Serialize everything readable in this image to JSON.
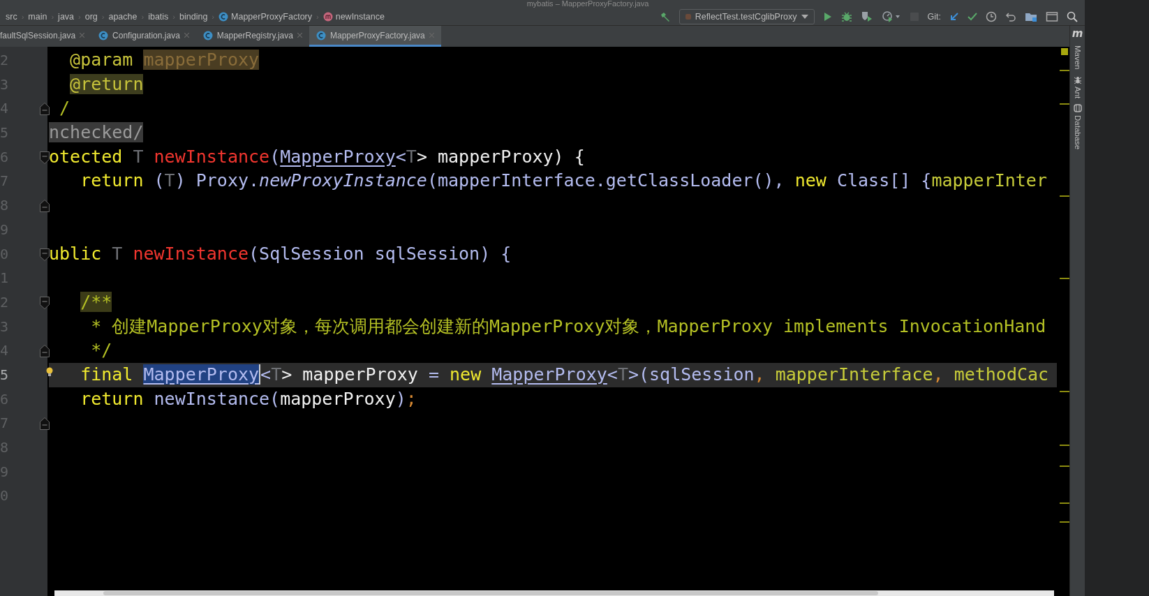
{
  "window": {
    "title": "mybatis – MapperProxyFactory.java"
  },
  "breadcrumbs": [
    {
      "label": "src",
      "kind": "folder"
    },
    {
      "separator": "›",
      "label": "main",
      "kind": "folder"
    },
    {
      "separator": "›",
      "label": "java",
      "kind": "folder"
    },
    {
      "separator": "›",
      "label": "org",
      "kind": "folder"
    },
    {
      "separator": "›",
      "label": "apache",
      "kind": "folder"
    },
    {
      "separator": "›",
      "label": "ibatis",
      "kind": "folder"
    },
    {
      "separator": "›",
      "label": "binding",
      "kind": "folder"
    },
    {
      "separator": "›",
      "label": "MapperProxyFactory",
      "kind": "class"
    },
    {
      "separator": "›",
      "label": "newInstance",
      "kind": "method"
    }
  ],
  "run_config": {
    "label": "ReflectTest.testCglibProxy"
  },
  "actions": [
    {
      "kind": "run",
      "disabled": false
    },
    {
      "kind": "debug",
      "disabled": false
    },
    {
      "kind": "coverage",
      "disabled": false
    },
    {
      "kind": "profile",
      "disabled": false
    },
    {
      "kind": "stop",
      "disabled": true
    }
  ],
  "git": {
    "label": "Git:"
  },
  "tabs": [
    {
      "label": "faultSqlSession.java",
      "icon": false,
      "selected": false
    },
    {
      "label": "Configuration.java",
      "icon": true,
      "selected": false
    },
    {
      "label": "MapperRegistry.java",
      "icon": true,
      "selected": false
    },
    {
      "label": "MapperProxyFactory.java",
      "icon": true,
      "selected": true
    }
  ],
  "tool_strip": {
    "logo": "m",
    "items": [
      {
        "label": "Maven",
        "kind": "none"
      },
      {
        "label": "Ant",
        "kind": "ant"
      },
      {
        "label": "Database",
        "kind": "database"
      }
    ]
  },
  "lines": [
    {
      "number": "2",
      "current": false,
      "bulb": false,
      "fold_start": false,
      "fold_end": false,
      "tokens": [
        {
          "text": "  @param ",
          "kind": "doctag"
        },
        {
          "text": "mapperProxy",
          "kind": "param_ref"
        }
      ]
    },
    {
      "number": "3",
      "current": false,
      "bulb": false,
      "fold_start": false,
      "fold_end": false,
      "tokens": [
        {
          "text": "  @return",
          "kind": "doctag_hl"
        }
      ]
    },
    {
      "number": "4",
      "current": false,
      "bulb": false,
      "fold_start": false,
      "fold_end": true,
      "tokens": [
        {
          "text": " /",
          "kind": "doc"
        }
      ]
    },
    {
      "number": "5",
      "current": false,
      "bulb": false,
      "fold_start": false,
      "fold_end": false,
      "tokens": [
        {
          "text": "nchecked/",
          "kind": "folded"
        }
      ]
    },
    {
      "number": "6",
      "current": false,
      "bulb": false,
      "fold_start": true,
      "fold_end": false,
      "tokens": [
        {
          "text": "otected ",
          "kind": "keyword"
        },
        {
          "text": "T ",
          "kind": "typeparam"
        },
        {
          "text": "newInstance",
          "kind": "method"
        },
        {
          "text": "(",
          "kind": "ident"
        },
        {
          "text": "MapperProxy",
          "kind": "class"
        },
        {
          "text": "<",
          "kind": "ident"
        },
        {
          "text": "T",
          "kind": "typeparam"
        },
        {
          "text": "> mapperProxy) {",
          "kind": "white"
        }
      ]
    },
    {
      "number": "7",
      "current": false,
      "bulb": false,
      "fold_start": false,
      "fold_end": false,
      "tokens": [
        {
          "text": "   return",
          "kind": "keyword"
        },
        {
          "text": " (",
          "kind": "ident"
        },
        {
          "text": "T",
          "kind": "typeparam"
        },
        {
          "text": ") Proxy.",
          "kind": "ident"
        },
        {
          "text": "newProxyInstance",
          "kind": "italic"
        },
        {
          "text": "(mapperInterface.getClassLoader(), ",
          "kind": "ident"
        },
        {
          "text": "new",
          "kind": "keyword"
        },
        {
          "text": " Class[] {",
          "kind": "ident"
        },
        {
          "text": "mapperInter",
          "kind": "field"
        }
      ]
    },
    {
      "number": "8",
      "current": false,
      "bulb": false,
      "fold_start": false,
      "fold_end": true
    },
    {
      "number": "9",
      "current": false,
      "bulb": false,
      "fold_start": false,
      "fold_end": false
    },
    {
      "number": "0",
      "current": false,
      "bulb": false,
      "fold_start": true,
      "fold_end": false,
      "tokens": [
        {
          "text": "ublic ",
          "kind": "keyword"
        },
        {
          "text": "T ",
          "kind": "typeparam"
        },
        {
          "text": "newInstance",
          "kind": "method"
        },
        {
          "text": "(SqlSession sqlSession) {",
          "kind": "ident"
        }
      ]
    },
    {
      "number": "1",
      "current": false,
      "bulb": false,
      "fold_start": false,
      "fold_end": false
    },
    {
      "number": "2",
      "current": false,
      "bulb": false,
      "fold_start": true,
      "fold_end": false,
      "tokens": [
        {
          "text": "   /**",
          "kind": "doc_hl"
        }
      ]
    },
    {
      "number": "3",
      "current": false,
      "bulb": false,
      "fold_start": false,
      "fold_end": false,
      "tokens": [
        {
          "text": "    * 创建MapperProxy对象，每次调用都会创建新的MapperProxy对象，MapperProxy implements InvocationHand",
          "kind": "doc"
        }
      ]
    },
    {
      "number": "4",
      "current": false,
      "bulb": false,
      "fold_start": false,
      "fold_end": true,
      "tokens": [
        {
          "text": "    */",
          "kind": "doc"
        }
      ]
    },
    {
      "number": "5",
      "current": true,
      "bulb": true,
      "fold_start": false,
      "fold_end": false,
      "tokens": [
        {
          "text": "   final ",
          "kind": "keyword"
        },
        {
          "text": "MapperProxy",
          "kind": "class_sel"
        },
        {
          "text": "<",
          "kind": "ident"
        },
        {
          "text": "T",
          "kind": "typeparam"
        },
        {
          "text": "> mapperProxy ",
          "kind": "white"
        },
        {
          "text": "= ",
          "kind": "ident"
        },
        {
          "text": "new ",
          "kind": "keyword"
        },
        {
          "text": "MapperProxy",
          "kind": "class"
        },
        {
          "text": "<",
          "kind": "ident"
        },
        {
          "text": "T",
          "kind": "typeparam"
        },
        {
          "text": ">(sqlSession",
          "kind": "ident"
        },
        {
          "text": ", ",
          "kind": "comma"
        },
        {
          "text": "mapperInterface",
          "kind": "field"
        },
        {
          "text": ", ",
          "kind": "comma"
        },
        {
          "text": "methodCac",
          "kind": "field"
        }
      ]
    },
    {
      "number": "6",
      "current": false,
      "bulb": false,
      "fold_start": false,
      "fold_end": false,
      "tokens": [
        {
          "text": "   return",
          "kind": "keyword"
        },
        {
          "text": " newInstance(",
          "kind": "ident"
        },
        {
          "text": "mapperProxy",
          "kind": "white"
        },
        {
          "text": ")",
          "kind": "ident"
        },
        {
          "text": ";",
          "kind": "comma"
        }
      ]
    },
    {
      "number": "7",
      "current": false,
      "bulb": false,
      "fold_start": false,
      "fold_end": true
    },
    {
      "number": "8",
      "current": false,
      "bulb": false,
      "fold_start": false,
      "fold_end": false
    },
    {
      "number": "9",
      "current": false,
      "bulb": false,
      "fold_start": false,
      "fold_end": false
    },
    {
      "number": "0",
      "current": false,
      "bulb": false,
      "fold_start": false,
      "fold_end": false
    }
  ]
}
